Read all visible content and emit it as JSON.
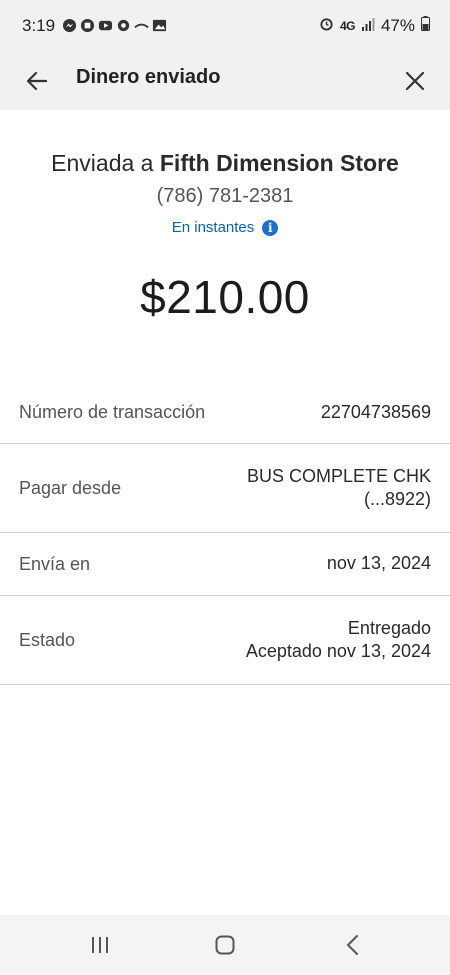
{
  "status_bar": {
    "time": "3:19",
    "network": "4G",
    "battery": "47%",
    "icons": [
      "messenger-icon",
      "app-icon",
      "youtube-icon",
      "app-icon",
      "app-icon",
      "gallery-icon",
      "alarm-icon",
      "signal-icon",
      "battery-icon"
    ]
  },
  "header": {
    "title": "Dinero enviado",
    "back_icon": "arrow-left-icon",
    "close_icon": "close-icon"
  },
  "summary": {
    "sent_prefix": "Enviada a",
    "payee": "Fifth Dimension Store",
    "phone": "(786) 781-2381",
    "speed": "En instantes",
    "info_icon": "i",
    "amount": "$210.00"
  },
  "details": [
    {
      "label": "Número de transacción",
      "value_line1": "22704738569",
      "value_line2": ""
    },
    {
      "label": "Pagar desde",
      "value_line1": "BUS COMPLETE CHK",
      "value_line2": "(...8922)"
    },
    {
      "label": "Envía en",
      "value_line1": "nov 13, 2024",
      "value_line2": ""
    },
    {
      "label": "Estado",
      "value_line1": "Entregado",
      "value_line2": "Aceptado nov 13, 2024"
    }
  ],
  "colors": {
    "header_bg": "#f1f1f3",
    "link_blue": "#0b62a8",
    "info_blue": "#1a73c9",
    "divider": "#cfcfcf"
  }
}
